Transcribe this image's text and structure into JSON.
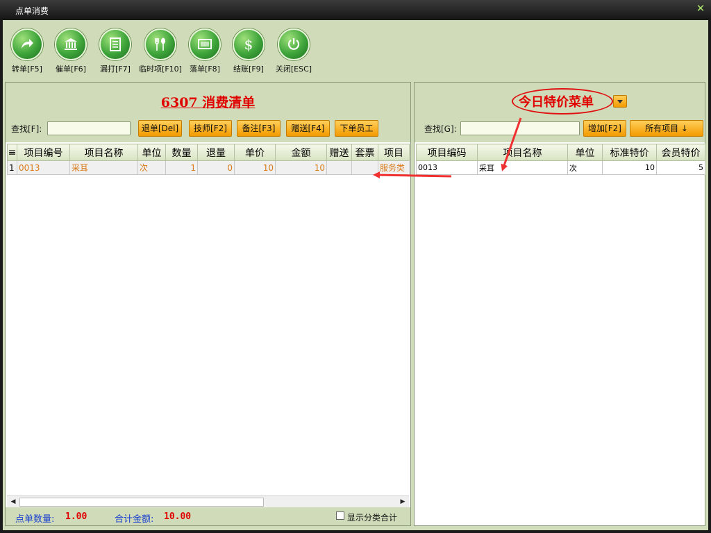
{
  "window": {
    "title": "点单消费"
  },
  "toolbar": {
    "buttons": [
      {
        "label": "转单[F5]",
        "icon": "forward-arrow-icon"
      },
      {
        "label": "催单[F6]",
        "icon": "bank-icon"
      },
      {
        "label": "漏打[F7]",
        "icon": "document-icon"
      },
      {
        "label": "临时项[F10]",
        "icon": "utensils-icon"
      },
      {
        "label": "落单[F8]",
        "icon": "screen-icon"
      },
      {
        "label": "结账[F9]",
        "icon": "dollar-icon"
      },
      {
        "label": "关闭[ESC]",
        "icon": "power-icon"
      }
    ]
  },
  "left": {
    "title": "6307 消费清单",
    "search": {
      "label": "查找[F]:",
      "value": ""
    },
    "buttons": [
      "退单[Del]",
      "技师[F2]",
      "备注[F3]",
      "赠送[F4]",
      "下单员工"
    ],
    "columns": [
      "≡",
      "项目编号",
      "项目名称",
      "单位",
      "数量",
      "退量",
      "单价",
      "金额",
      "赠送",
      "套票",
      "项目"
    ],
    "rows": [
      {
        "idx": "1",
        "code": "0013",
        "name": "采耳",
        "unit": "次",
        "qty": "1",
        "ret": "0",
        "price": "10",
        "amount": "10",
        "gift": "",
        "ticket": "",
        "type": "服务类"
      }
    ],
    "footer": {
      "count_label": "点单数量:",
      "count_value": "1.00",
      "total_label": "合计金额:",
      "total_value": "10.00",
      "checkbox_label": "显示分类合计"
    }
  },
  "right": {
    "title": "今日特价菜单",
    "search": {
      "label": "查找[G]:",
      "value": ""
    },
    "buttons": [
      "增加[F2]",
      "所有项目 ↓"
    ],
    "columns": [
      "项目编码",
      "项目名称",
      "单位",
      "标准特价",
      "会员特价"
    ],
    "rows": [
      {
        "code": "0013",
        "name": "采耳",
        "unit": "次",
        "std": "10",
        "member": "5"
      }
    ]
  },
  "colors": {
    "accent_red": "#e00000",
    "panel_bg": "#d0dcb9",
    "button_orange": "#f39a00",
    "label_blue": "#1a3fcf"
  }
}
